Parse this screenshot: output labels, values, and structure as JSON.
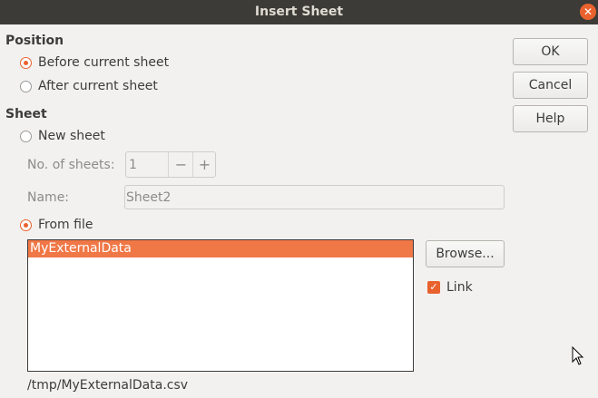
{
  "dialog": {
    "title": "Insert Sheet",
    "close_glyph": "✕"
  },
  "position": {
    "title": "Position",
    "options": [
      {
        "label": "Before current sheet",
        "checked": true
      },
      {
        "label": "After current sheet",
        "checked": false
      }
    ]
  },
  "sheet": {
    "title": "Sheet",
    "new_sheet_label": "New sheet",
    "num_sheets_label": "No. of sheets:",
    "num_sheets_value": "1",
    "minus_glyph": "−",
    "plus_glyph": "+",
    "name_label": "Name:",
    "name_value": "Sheet2",
    "from_file_label": "From file",
    "list_items": [
      "MyExternalData"
    ],
    "browse_label": "Browse...",
    "link_label": "Link",
    "link_checked": true,
    "file_path": "/tmp/MyExternalData.csv"
  },
  "buttons": {
    "ok": "OK",
    "cancel": "Cancel",
    "help": "Help"
  },
  "colors": {
    "accent": "#e9622e",
    "selection": "#f07746",
    "titlebar": "#3c3b37"
  }
}
